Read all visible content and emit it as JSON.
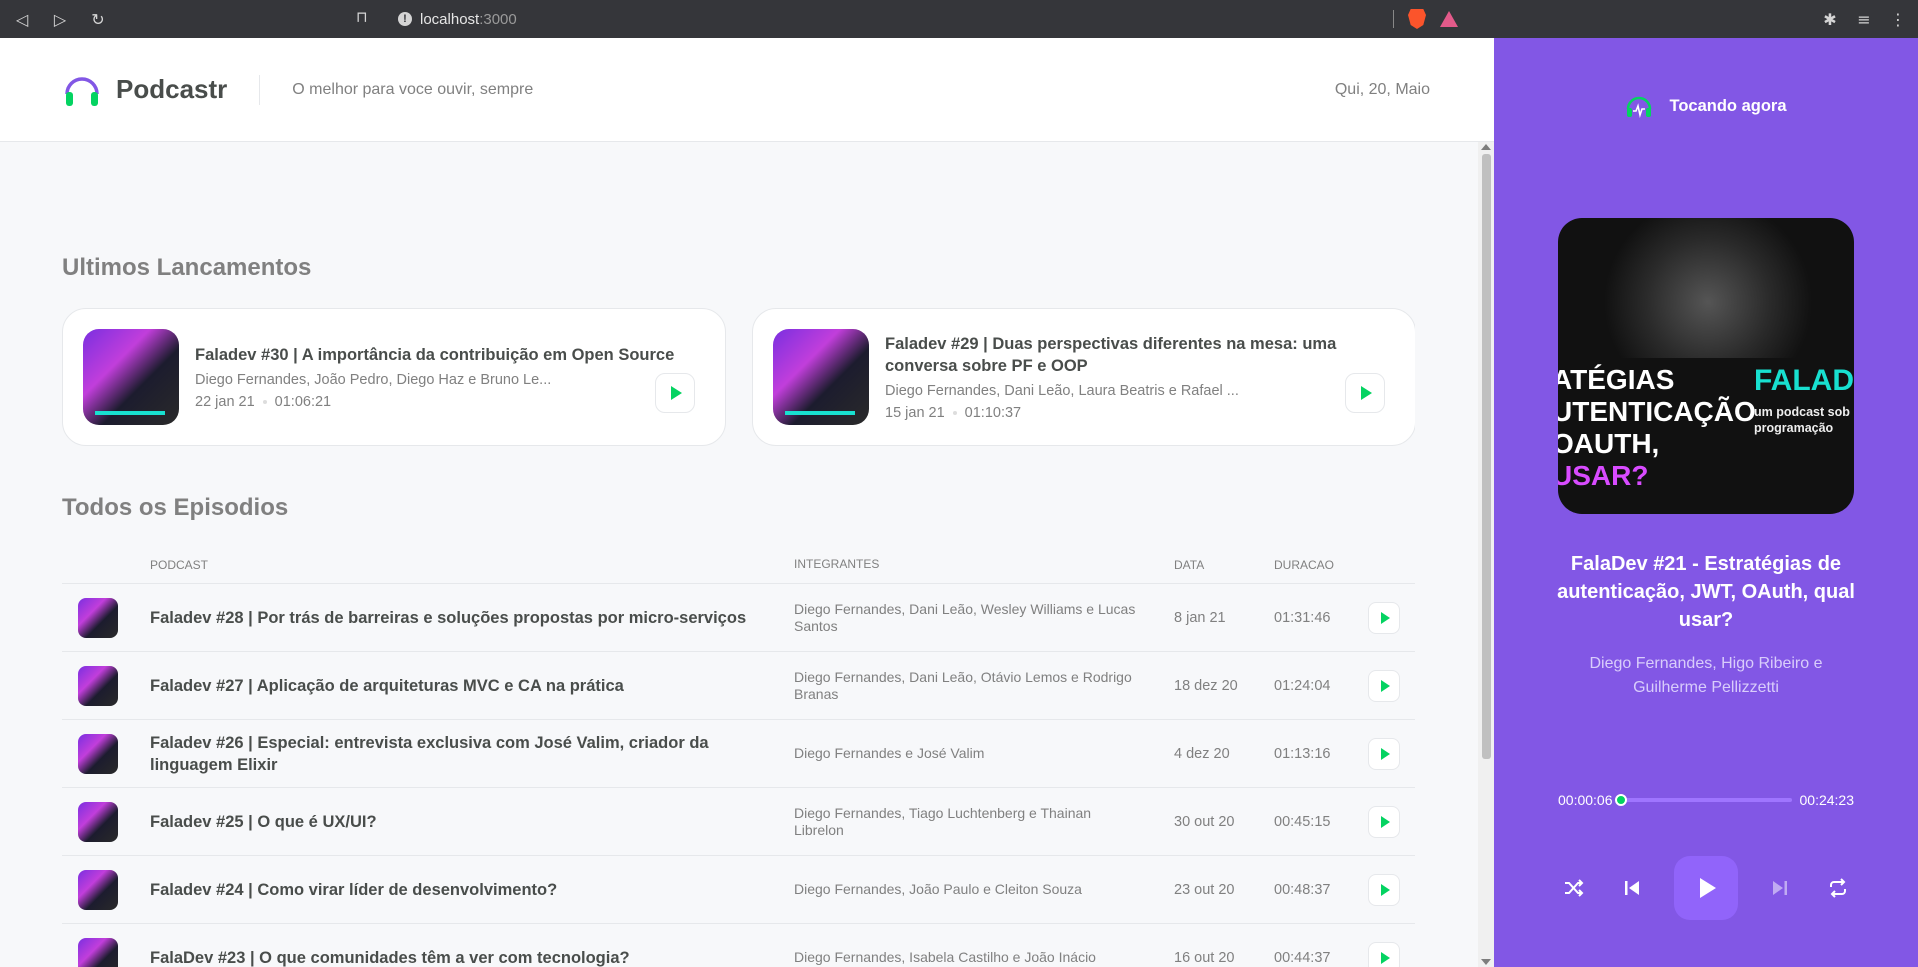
{
  "browser": {
    "url_host": "localhost",
    "url_port": ":3000"
  },
  "header": {
    "brand": "Podcastr",
    "tagline": "O melhor para voce ouvir, sempre",
    "date": "Qui, 20, Maio"
  },
  "latest": {
    "title": "Ultimos Lancamentos",
    "cards": [
      {
        "title": "Faladev #30 | A importância da contribuição em Open Source",
        "members": "Diego Fernandes, João Pedro, Diego Haz e Bruno Le...",
        "date": "22 jan 21",
        "duration": "01:06:21"
      },
      {
        "title": "Faladev #29 | Duas perspectivas diferentes na mesa: uma conversa sobre PF e OOP",
        "members": "Diego Fernandes, Dani Leão, Laura Beatris e Rafael ...",
        "date": "15 jan 21",
        "duration": "01:10:37"
      }
    ]
  },
  "all": {
    "title": "Todos os Episodios",
    "columns": {
      "podcast": "PODCAST",
      "members": "INTEGRANTES",
      "date": "DATA",
      "duration": "DURACAO"
    },
    "rows": [
      {
        "title": "Faladev #28 | Por trás de barreiras e soluções propostas por micro-serviços",
        "members": "Diego Fernandes, Dani Leão, Wesley Williams e Lucas Santos",
        "date": "8 jan 21",
        "duration": "01:31:46"
      },
      {
        "title": "Faladev #27 | Aplicação de arquiteturas MVC e CA na prática",
        "members": "Diego Fernandes, Dani Leão, Otávio Lemos e Rodrigo Branas",
        "date": "18 dez 20",
        "duration": "01:24:04"
      },
      {
        "title": "Faladev #26 | Especial: entrevista exclusiva com José Valim, criador da linguagem Elixir",
        "members": "Diego Fernandes e José Valim",
        "date": "4 dez 20",
        "duration": "01:13:16"
      },
      {
        "title": "Faladev #25 | O que é UX/UI?",
        "members": "Diego Fernandes, Tiago Luchtenberg e Thainan Librelon",
        "date": "30 out 20",
        "duration": "00:45:15"
      },
      {
        "title": "Faladev #24 | Como virar líder de desenvolvimento?",
        "members": "Diego Fernandes, João Paulo e Cleiton Souza",
        "date": "23 out 20",
        "duration": "00:48:37"
      },
      {
        "title": "FalaDev #23 | O que comunidades têm a ver com tecnologia?",
        "members": "Diego Fernandes, Isabela Castilho e João Inácio",
        "date": "16 out 20",
        "duration": "00:44:37"
      }
    ]
  },
  "player": {
    "heading": "Tocando agora",
    "cover_text": {
      "line1": "ATÉGIAS",
      "line2": "UTENTICAÇÃO",
      "line3": "OAUTH,",
      "line4": " USAR?",
      "brand": "FALAD",
      "brand_sub1": "um podcast sob",
      "brand_sub2": "programação"
    },
    "episode_title": "FalaDev #21 - Estratégias de autenticação, JWT, OAuth, qual usar?",
    "members": "Diego Fernandes, Higo Ribeiro e Guilherme Pellizzetti",
    "current_time": "00:00:06",
    "total_time": "00:24:23",
    "progress": 0.004,
    "accent": "#8257e5",
    "green": "#04d361"
  }
}
